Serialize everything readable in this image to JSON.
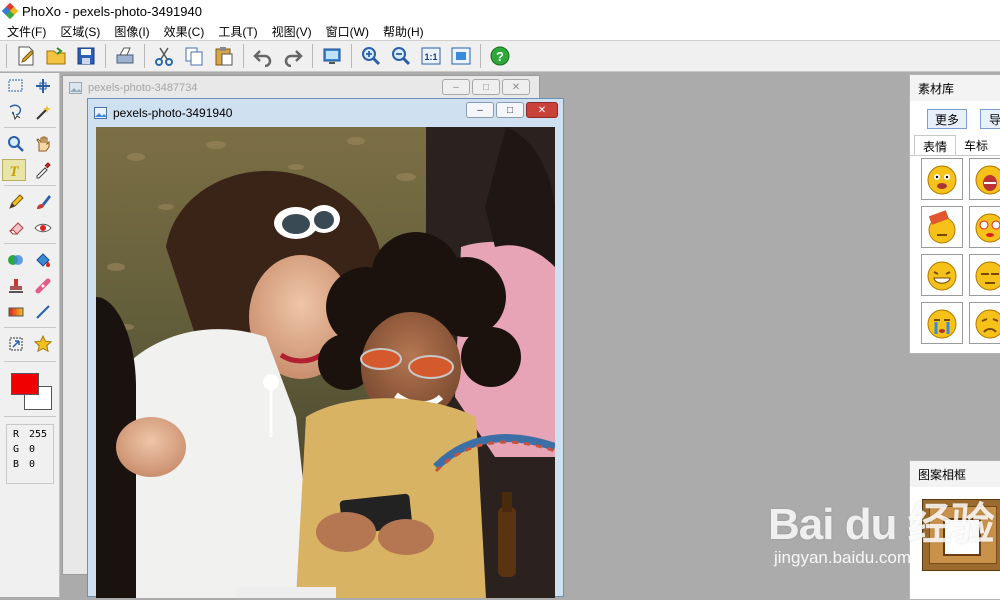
{
  "app": {
    "window_title": "PhoXo - pexels-photo-3491940"
  },
  "menu": [
    "文件(F)",
    "区域(S)",
    "图像(I)",
    "效果(C)",
    "工具(T)",
    "视图(V)",
    "窗口(W)",
    "帮助(H)"
  ],
  "toolbar": {
    "buttons": [
      "new-file-icon",
      "open-folder-icon",
      "save-icon",
      "scan-icon",
      "cut-icon",
      "copy-icon",
      "paste-icon",
      "undo-icon",
      "redo-icon",
      "screen-capture-icon",
      "zoom-in-icon",
      "zoom-out-icon",
      "actual-size-icon",
      "fit-window-icon",
      "help-icon"
    ],
    "actual_size_label": "1:1"
  },
  "palette": {
    "active_tool": "text-tool",
    "foreground_color": "#f00000",
    "background_color": "#ffffff",
    "rgb": {
      "r_label": "R",
      "r": "255",
      "g_label": "G",
      "g": "0",
      "b_label": "B",
      "b": "0"
    }
  },
  "documents": {
    "back": {
      "title": "pexels-photo-3487734"
    },
    "front": {
      "title": "pexels-photo-3491940"
    }
  },
  "material_panel": {
    "title": "素材库",
    "more_button": "更多",
    "import_button": "导",
    "tabs": [
      "表情",
      "车标"
    ],
    "active_tab": "表情",
    "emoticons": [
      "grin-emoticon",
      "shout-emoticon",
      "hammer-emoticon",
      "dizzy-emoticon",
      "laugh-emoticon",
      "sleepy-emoticon",
      "crying-emoticon",
      "sad-emoticon"
    ]
  },
  "frame_panel": {
    "title": "图案相框"
  },
  "watermark": {
    "logo": "Bai du 经验",
    "url": "jingyan.baidu.com"
  }
}
